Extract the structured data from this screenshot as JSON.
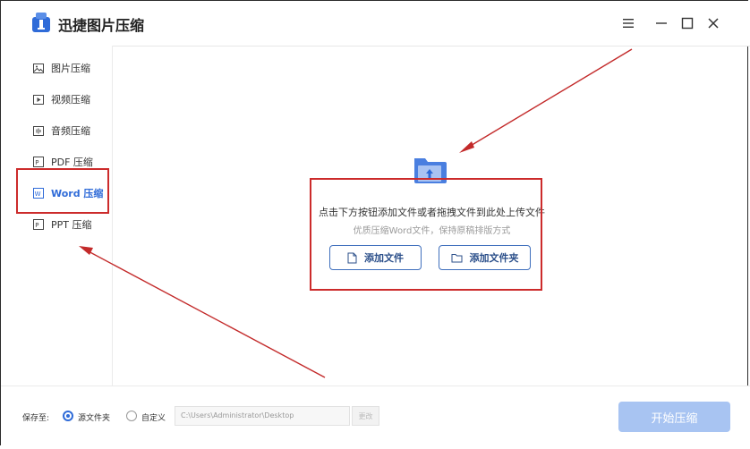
{
  "app": {
    "title": "迅捷图片压缩"
  },
  "sidebar": {
    "items": [
      {
        "label": "图片压缩",
        "icon": "image-icon"
      },
      {
        "label": "视频压缩",
        "icon": "video-icon"
      },
      {
        "label": "音频压缩",
        "icon": "audio-icon"
      },
      {
        "label": "PDF 压缩",
        "icon": "pdf-icon"
      },
      {
        "label": "Word 压缩",
        "icon": "word-icon",
        "active": true
      },
      {
        "label": "PPT 压缩",
        "icon": "ppt-icon"
      }
    ]
  },
  "main": {
    "hint_main": "点击下方按钮添加文件或者拖拽文件到此处上传文件",
    "hint_sub": "优质压缩Word文件，保持原稿排版方式",
    "add_file_label": "添加文件",
    "add_folder_label": "添加文件夹"
  },
  "bottom": {
    "save_label": "保存至:",
    "option_source": "源文件夹",
    "option_custom": "自定义",
    "path_value": "C:\\Users\\Administrator\\Desktop",
    "change_label": "更改",
    "start_label": "开始压缩"
  },
  "colors": {
    "accent": "#2f6bd8",
    "annotation": "#cc2b2b",
    "start_button": "#a8c4f2"
  }
}
